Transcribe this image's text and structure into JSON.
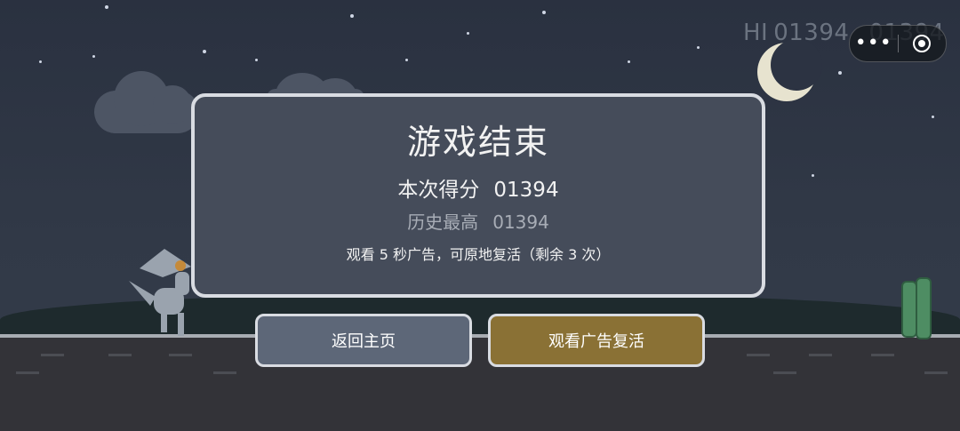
{
  "hud": {
    "hi_label": "HI",
    "hi_score": "01394",
    "current_score": "01394"
  },
  "capsule": {
    "more_glyph": "•••"
  },
  "dialog": {
    "title": "游戏结束",
    "score_label": "本次得分",
    "score_value": "01394",
    "best_label": "历史最高",
    "best_value": "01394",
    "hint": "观看 5 秒广告，可原地复活（剩余 3 次）"
  },
  "buttons": {
    "home": "返回主页",
    "watch_ad": "观看广告复活"
  },
  "colors": {
    "sky": "#2f3644",
    "dialog_bg": "#454c5a",
    "home_button": "#5d6778",
    "ad_button": "#8a7135",
    "moon": "#e7e3cf",
    "cactus": "#4e8d63"
  }
}
